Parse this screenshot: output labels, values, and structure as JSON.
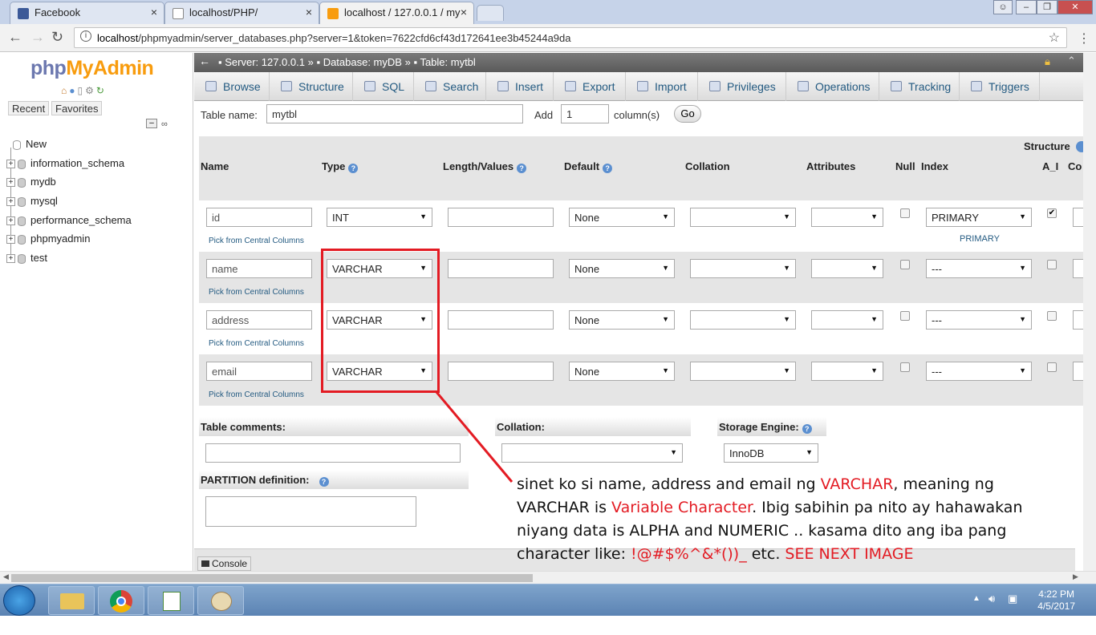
{
  "browser": {
    "tabs": [
      {
        "title": "Facebook",
        "close": "×"
      },
      {
        "title": "localhost/PHP/",
        "close": "×"
      },
      {
        "title": "localhost / 127.0.0.1 / my",
        "close": "×"
      }
    ],
    "url_host": "localhost",
    "url_path": "/phpmyadmin/server_databases.php?server=1&token=7622cfd6cf43d172641ee3b45244a9da"
  },
  "sidebar": {
    "logo_php": "php",
    "logo_rest": "MyAdmin",
    "recent": "Recent",
    "favorites": "Favorites",
    "items": [
      "New",
      "information_schema",
      "mydb",
      "mysql",
      "performance_schema",
      "phpmyadmin",
      "test"
    ]
  },
  "breadcrumb": {
    "server": "Server: 127.0.0.1",
    "database": "Database: myDB",
    "table": "Table: mytbl",
    "sep": "»"
  },
  "tabs": [
    "Browse",
    "Structure",
    "SQL",
    "Search",
    "Insert",
    "Export",
    "Import",
    "Privileges",
    "Operations",
    "Tracking",
    "Triggers"
  ],
  "form": {
    "table_name_label": "Table name:",
    "table_name_value": "mytbl",
    "add_label": "Add",
    "add_value": "1",
    "columns_label": "column(s)",
    "go": "Go",
    "structure_label": "Structure"
  },
  "headers": {
    "name": "Name",
    "type": "Type",
    "length": "Length/Values",
    "default": "Default",
    "collation": "Collation",
    "attributes": "Attributes",
    "null": "Null",
    "index": "Index",
    "ai": "A_I",
    "comments": "Co"
  },
  "rows": [
    {
      "name": "id",
      "type": "INT",
      "default": "None",
      "index": "PRIMARY",
      "index_note": "PRIMARY",
      "pick": "Pick from Central Columns",
      "ai": "✔"
    },
    {
      "name": "name",
      "type": "VARCHAR",
      "default": "None",
      "index": "---",
      "index_note": "",
      "pick": "Pick from Central Columns",
      "ai": ""
    },
    {
      "name": "address",
      "type": "VARCHAR",
      "default": "None",
      "index": "---",
      "index_note": "",
      "pick": "Pick from Central Columns",
      "ai": ""
    },
    {
      "name": "email",
      "type": "VARCHAR",
      "default": "None",
      "index": "---",
      "index_note": "",
      "pick": "Pick from Central Columns",
      "ai": ""
    }
  ],
  "bottom": {
    "table_comments": "Table comments:",
    "collation": "Collation:",
    "storage_engine": "Storage Engine:",
    "engine_value": "InnoDB",
    "partition": "PARTITION definition:",
    "console": "Console"
  },
  "annotation": {
    "p1": "sinet ko si name, address and email ng ",
    "r1": "VARCHAR",
    "p2": ", meaning ng VARCHAR is ",
    "r2": "Variable Character",
    "p3": ". Ibig sabihin pa nito ay hahawakan niyang data is ALPHA and NUMERIC .. kasama dito ang iba pang character like: ",
    "r3": "!@#$%^&*())_",
    "p4": " etc. ",
    "r4": "SEE NEXT IMAGE"
  },
  "taskbar": {
    "time": "4:22 PM",
    "date": "4/5/2017"
  },
  "colors": {
    "accent_red": "#e31b23",
    "pma_link": "#235a81",
    "logo_blue": "#6c78af",
    "logo_orange": "#f89c0e"
  }
}
